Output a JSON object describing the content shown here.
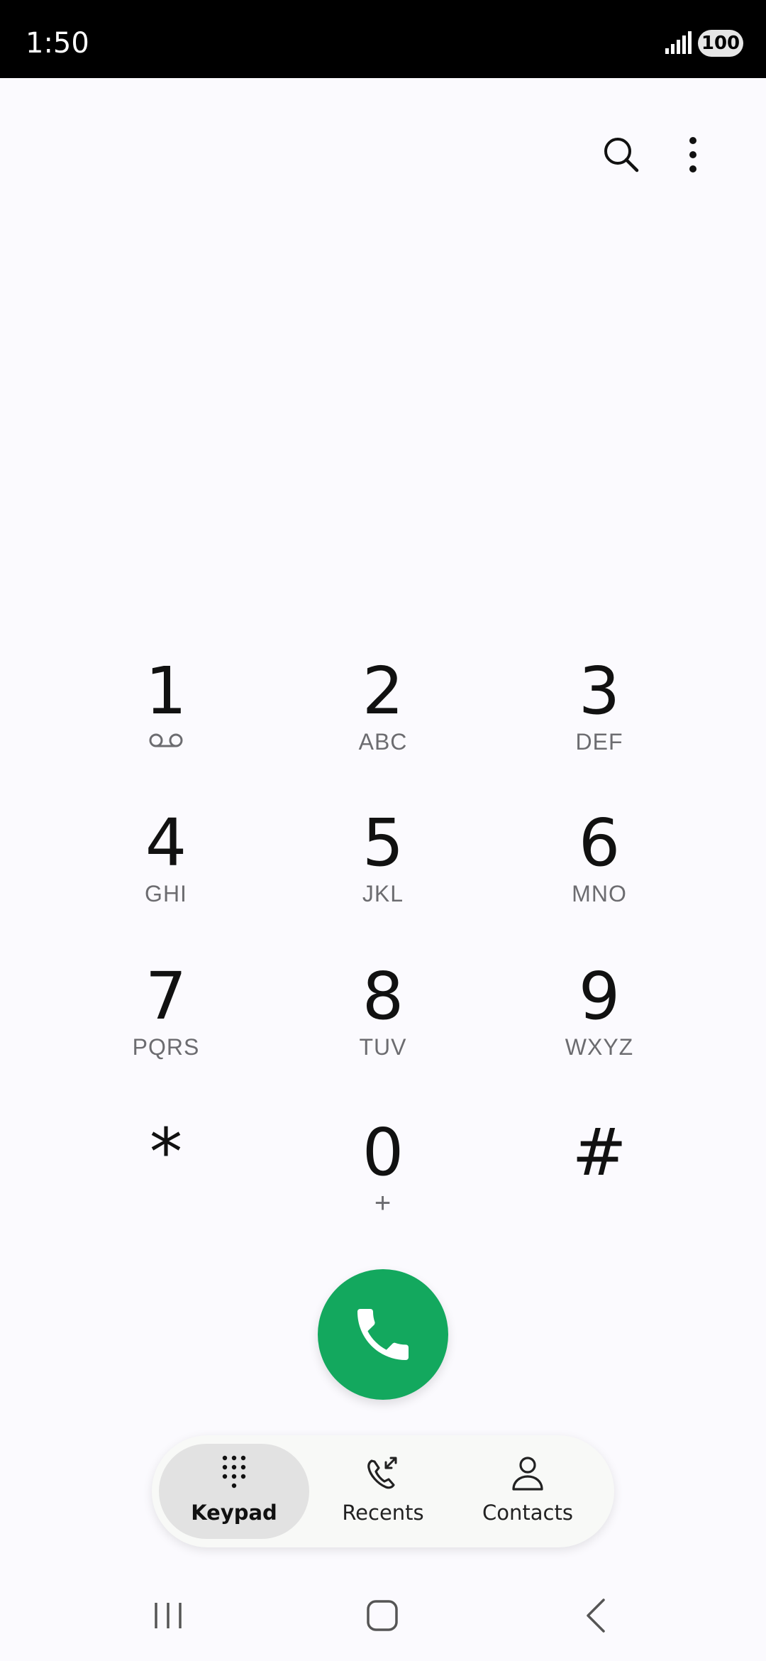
{
  "status_bar": {
    "time": "1:50",
    "battery": "100",
    "icons": [
      "signal-icon",
      "battery-icon"
    ]
  },
  "top_actions": {
    "icons": [
      "search-icon",
      "more-vertical-icon"
    ]
  },
  "keypad": {
    "keys": [
      {
        "digit": "1",
        "letters": "",
        "sub_icon": "voicemail-icon"
      },
      {
        "digit": "2",
        "letters": "ABC"
      },
      {
        "digit": "3",
        "letters": "DEF"
      },
      {
        "digit": "4",
        "letters": "GHI"
      },
      {
        "digit": "5",
        "letters": "JKL"
      },
      {
        "digit": "6",
        "letters": "MNO"
      },
      {
        "digit": "7",
        "letters": "PQRS"
      },
      {
        "digit": "8",
        "letters": "TUV"
      },
      {
        "digit": "9",
        "letters": "WXYZ"
      },
      {
        "digit": "*",
        "letters": ""
      },
      {
        "digit": "0",
        "letters": "+"
      },
      {
        "digit": "#",
        "letters": ""
      }
    ]
  },
  "call_button": {
    "icon": "phone-icon",
    "color": "#13a85e"
  },
  "tabs": [
    {
      "label": "Keypad",
      "icon": "keypad-icon",
      "active": true
    },
    {
      "label": "Recents",
      "icon": "recents-icon",
      "active": false
    },
    {
      "label": "Contacts",
      "icon": "contacts-icon",
      "active": false
    }
  ],
  "system_nav": {
    "icons": [
      "recent-apps-icon",
      "home-icon",
      "back-icon"
    ]
  }
}
